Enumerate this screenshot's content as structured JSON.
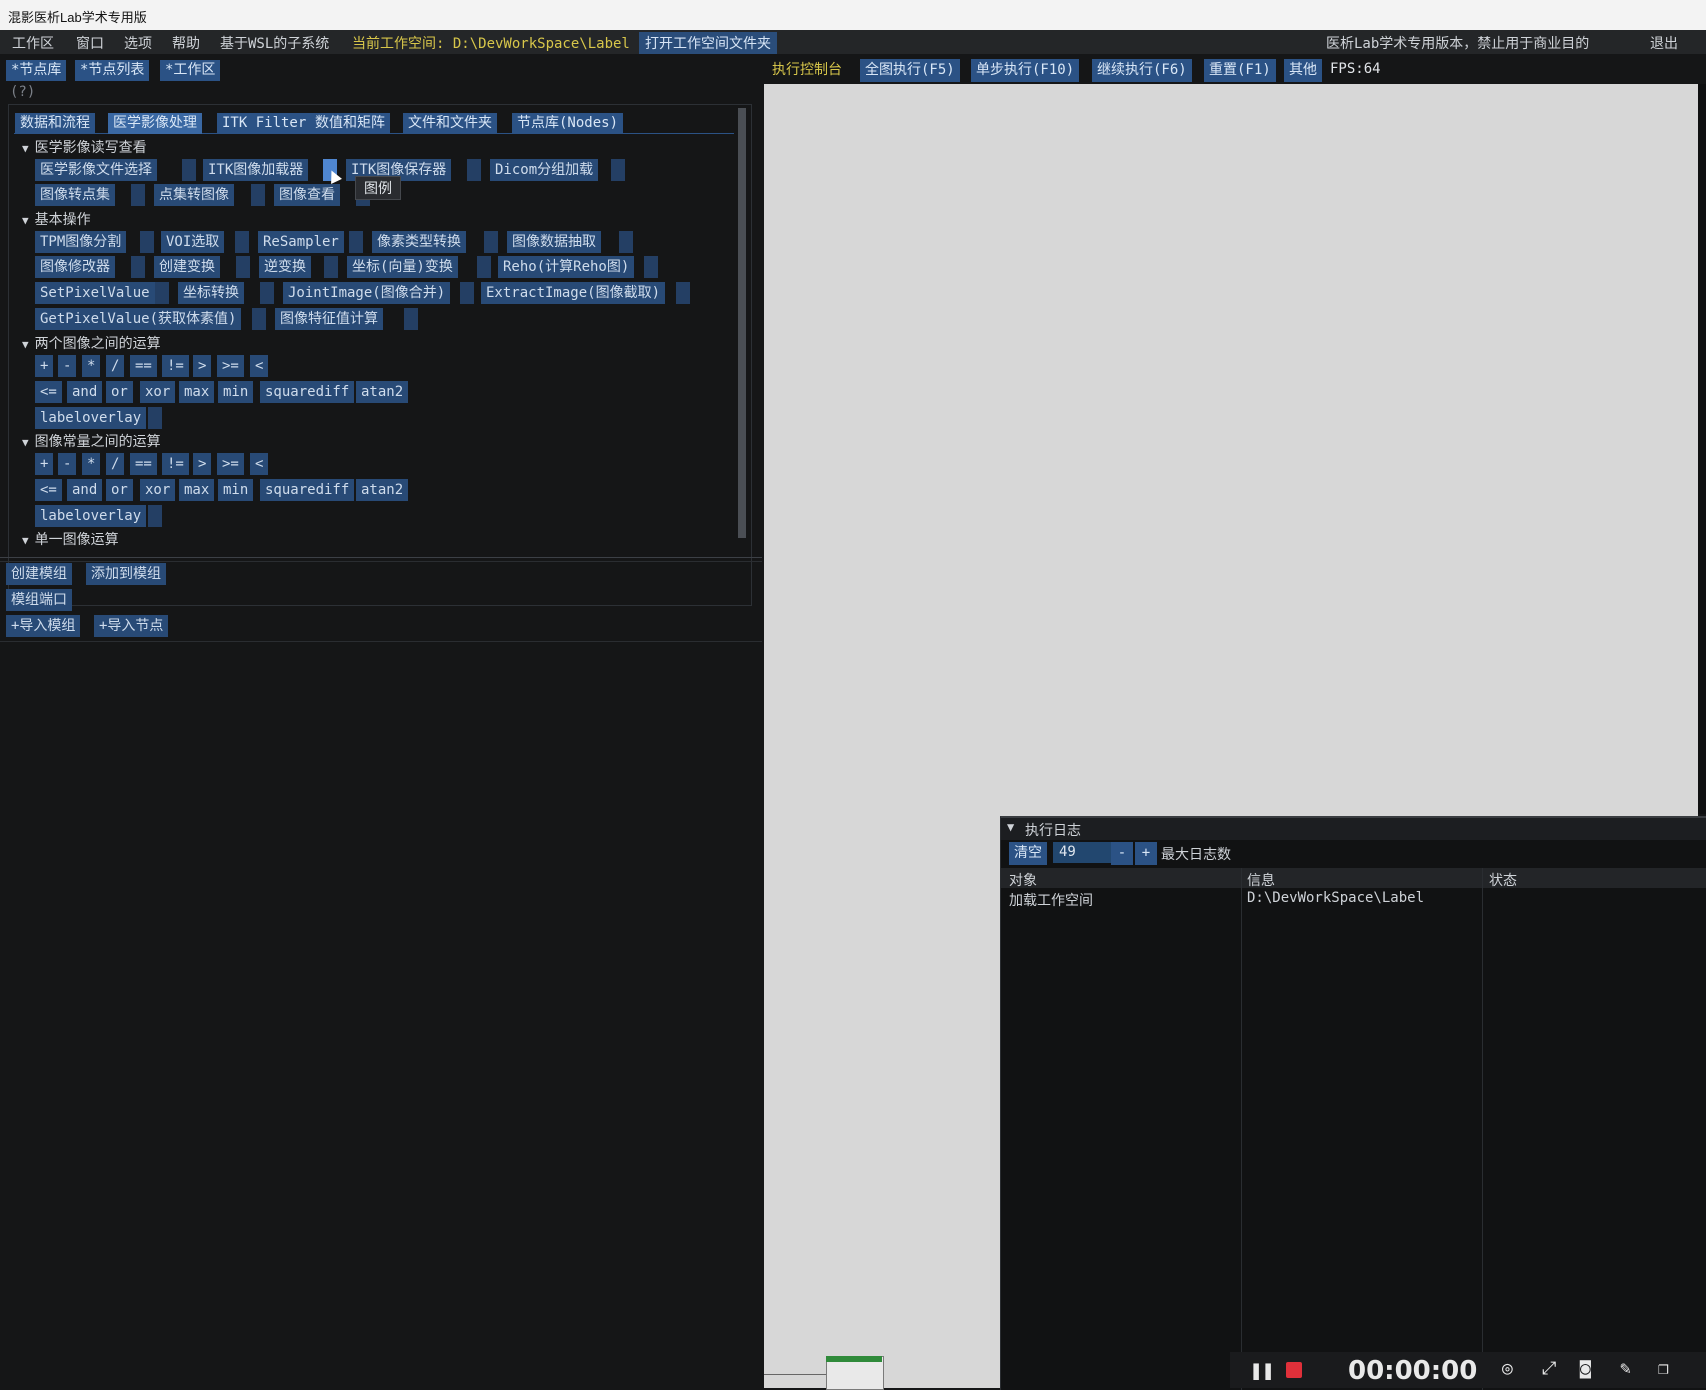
{
  "window": {
    "title": "混影医析Lab学术专用版"
  },
  "menu": {
    "items": [
      "工作区",
      "窗口",
      "选项",
      "帮助",
      "基于WSL的子系统"
    ],
    "workspace_label": "当前工作空间: D:\\DevWorkSpace\\Label",
    "open_folder": "打开工作空间文件夹",
    "notice": "医析Lab学术专用版本，禁止用于商业目的",
    "exit": "退出"
  },
  "left_tabs": [
    "*节点库",
    "*节点列表",
    "*工作区"
  ],
  "help_hint": "(?)",
  "category_tabs": [
    "数据和流程",
    "医学影像处理",
    "ITK Filter",
    "数值和矩阵",
    "文件和文件夹",
    "节点库(Nodes)"
  ],
  "sections": {
    "s1": {
      "title": "医学影像读写查看",
      "row1": [
        "医学影像文件选择",
        "ITK图像加载器",
        "ITK图像保存器",
        "Dicom分组加载"
      ],
      "row2": [
        "图像转点集",
        "点集转图像",
        "图像查看"
      ],
      "tooltip": "图例"
    },
    "s2": {
      "title": "基本操作",
      "row1": [
        "TPM图像分割",
        "VOI选取",
        "ReSampler",
        "像素类型转换",
        "图像数据抽取"
      ],
      "row2": [
        "图像修改器",
        "创建变换",
        "逆变换",
        "坐标(向量)变换",
        "Reho(计算Reho图)"
      ],
      "row3": [
        "SetPixelValue",
        "坐标转换",
        "JointImage(图像合并)",
        "ExtractImage(图像截取)"
      ],
      "row4": [
        "GetPixelValue(获取体素值)",
        "图像特征值计算"
      ]
    },
    "s3": {
      "title": "两个图像之间的运算",
      "row1": [
        "+",
        "-",
        "*",
        "/",
        "==",
        "!=",
        ">",
        ">=",
        "<"
      ],
      "row2": [
        "<=",
        "and",
        "or",
        "xor",
        "max",
        "min",
        "squarediff",
        "atan2"
      ],
      "row3": [
        "labeloverlay"
      ]
    },
    "s4": {
      "title": "图像常量之间的运算",
      "row1": [
        "+",
        "-",
        "*",
        "/",
        "==",
        "!=",
        ">",
        ">=",
        "<"
      ],
      "row2": [
        "<=",
        "and",
        "or",
        "xor",
        "max",
        "min",
        "squarediff",
        "atan2"
      ],
      "row3": [
        "labeloverlay"
      ]
    },
    "s5": {
      "title": "单一图像运算"
    }
  },
  "module_buttons": {
    "create": "创建模组",
    "add": "添加到模组",
    "port": "模组端口",
    "import_module": "+导入模组",
    "import_node": "+导入节点"
  },
  "control": {
    "title": "执行控制台",
    "run_all": "全图执行(F5)",
    "step": "单步执行(F10)",
    "continue": "继续执行(F6)",
    "reset": "重置(F1)",
    "other": "其他",
    "fps": "FPS:64"
  },
  "log": {
    "title": "执行日志",
    "clear": "清空",
    "max_value": "49",
    "minus": "-",
    "plus": "+",
    "max_label": "最大日志数",
    "columns": [
      "对象",
      "信息",
      "状态"
    ],
    "rows": [
      {
        "object": "加载工作空间",
        "info": "D:\\DevWorkSpace\\Label",
        "status": ""
      }
    ]
  },
  "recorder": {
    "time": "00:00:00"
  },
  "colors": {
    "accent": "#2b5285",
    "warning": "#d7c64a",
    "record": "#e0303a"
  }
}
